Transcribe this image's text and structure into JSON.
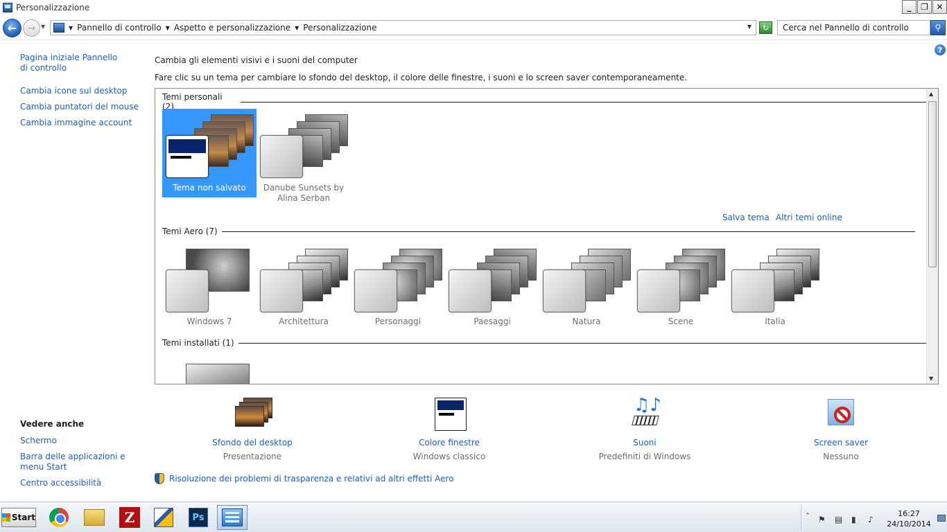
{
  "window": {
    "title": "Personalizzazione",
    "minimize": "_",
    "maximize": "❐",
    "close": "✕"
  },
  "nav": {
    "crumbs": [
      "Pannello di controllo",
      "Aspetto e personalizzazione",
      "Personalizzazione"
    ],
    "search_placeholder": "Cerca nel Pannello di controllo"
  },
  "left_pane": {
    "home_link": "Pagina iniziale Pannello di controllo",
    "links": [
      "Cambia icone sul desktop",
      "Cambia puntatori del mouse",
      "Cambia immagine account"
    ],
    "see_also_title": "Vedere anche",
    "see_also": [
      "Schermo",
      "Barra delle applicazioni e menu Start",
      "Centro accessibilità"
    ]
  },
  "main": {
    "heading": "Cambia gli elementi visivi e i suoni del computer",
    "description": "Fare clic su un tema per cambiare lo sfondo del desktop, il colore delle finestre, i suoni e lo screen saver contemporaneamente.",
    "groups": {
      "personal": "Temi personali (2)",
      "aero": "Temi Aero (7)",
      "installed": "Temi installati (1)"
    },
    "personal_themes": [
      "Tema non salvato",
      "Danube Sunsets by Alina Serban"
    ],
    "aero_themes": [
      "Windows 7",
      "Architettura",
      "Personaggi",
      "Paesaggi",
      "Natura",
      "Scene",
      "Italia"
    ],
    "save_theme": "Salva tema",
    "online_themes": "Altri temi online"
  },
  "bottom": [
    {
      "label": "Sfondo del desktop",
      "sub": "Presentazione"
    },
    {
      "label": "Colore finestre",
      "sub": "Windows classico"
    },
    {
      "label": "Suoni",
      "sub": "Predefiniti di Windows"
    },
    {
      "label": "Screen saver",
      "sub": "Nessuno"
    }
  ],
  "troubleshoot": "Risoluzione dei problemi di trasparenza e relativi ad altri effetti Aero",
  "taskbar": {
    "start": "Start",
    "ps": "Ps",
    "fz": "Z",
    "time": "16:27",
    "date": "24/10/2014"
  },
  "colors": {
    "link": "#1e5eb4",
    "selection": "#3399ff"
  }
}
